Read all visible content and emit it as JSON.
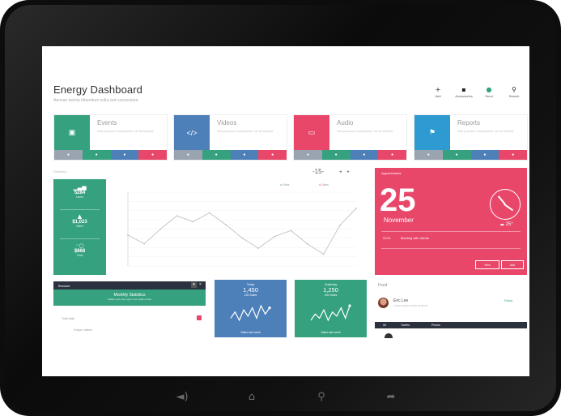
{
  "app": {
    "title": "Energy Dashboard",
    "subtitle": "Aenean lacinia bibendum nulla sed consectetur"
  },
  "toolbar": [
    {
      "icon": "plus-icon",
      "label": "Add"
    },
    {
      "icon": "briefcase-icon",
      "label": "Accessories"
    },
    {
      "icon": "tag-icon",
      "label": "Send"
    },
    {
      "icon": "search-icon",
      "label": "Search"
    }
  ],
  "tiles": [
    {
      "title": "Events",
      "desc": "Sed posuere consectetur est at lobortis",
      "color": "#35a17e",
      "icon": "image-icon"
    },
    {
      "title": "Videos",
      "desc": "Sed posuere consectetur est at lobortis",
      "color": "#4d80b9",
      "icon": "code-icon"
    },
    {
      "title": "Audio",
      "desc": "Sed posuere consectetur est at lobortis",
      "color": "#e8476a",
      "icon": "monitor-icon"
    },
    {
      "title": "Reports",
      "desc": "Sed posuere consectetur est at lobortis",
      "color": "#2d9bd1",
      "icon": "flag-icon"
    }
  ],
  "tile_bar_colors": [
    "#9aa3b0",
    "#35a17e",
    "#4d80b9",
    "#e8476a"
  ],
  "chart_panel": {
    "title": "Statistics",
    "counter": "15",
    "legend": [
      "Visits",
      "Sales"
    ],
    "legend_colors": [
      "#35a17e",
      "#e8476a"
    ]
  },
  "stats": [
    {
      "icon": "bar-chart-icon",
      "value": "5284",
      "label": "Users"
    },
    {
      "icon": "mountain-icon",
      "value": "$1,023",
      "label": "Sales"
    },
    {
      "icon": "coins-icon",
      "value": "$868",
      "label": "Total"
    }
  ],
  "chart_data": {
    "type": "line",
    "x": [
      1,
      2,
      3,
      4,
      5,
      6,
      7,
      8,
      9,
      10,
      11,
      12,
      13,
      14,
      15
    ],
    "series": [
      {
        "values": [
          42,
          30,
          50,
          68,
          60,
          72,
          56,
          38,
          24,
          40,
          48,
          30,
          16,
          55,
          78
        ]
      }
    ],
    "ylim": [
      0,
      100
    ],
    "grid": true
  },
  "appointment": {
    "label": "Appointments",
    "day": "25",
    "month": "November",
    "temp": "25°",
    "event_date": "21/11",
    "event_text": "Meeting with clients",
    "btn_view": "View",
    "btn_add": "Add"
  },
  "browser": {
    "title": "Browser",
    "band_title": "Monthly Statistics",
    "band_sub": "Nullam quis risus eget urna mollis ornare",
    "rows": [
      "Total visits",
      "Unique visitors"
    ]
  },
  "sparks": [
    {
      "head": "Today",
      "value": "1,450",
      "sub": "230 Sales",
      "foot": "Sales last week",
      "color": "#4d80b9",
      "values": [
        4,
        7,
        3,
        8,
        5,
        9,
        4,
        10,
        6,
        9
      ]
    },
    {
      "head": "Yesterday",
      "value": "1,250",
      "sub": "200 Sales",
      "foot": "Sales last week",
      "color": "#35a17e",
      "values": [
        3,
        6,
        4,
        8,
        3,
        7,
        5,
        9,
        4,
        10
      ]
    }
  ],
  "feed": {
    "title": "Feed",
    "name": "Eric Lee",
    "text": "Lorem ipsum dolor sit amet",
    "follow": "Follow",
    "tabs": [
      "All",
      "Tweets",
      "Photos"
    ]
  },
  "nav": [
    {
      "icon": "volume-icon",
      "glyph": "◄)"
    },
    {
      "icon": "home-icon",
      "glyph": "⌂"
    },
    {
      "icon": "search-icon",
      "glyph": "⚲"
    },
    {
      "icon": "back-icon",
      "glyph": "➦"
    }
  ]
}
